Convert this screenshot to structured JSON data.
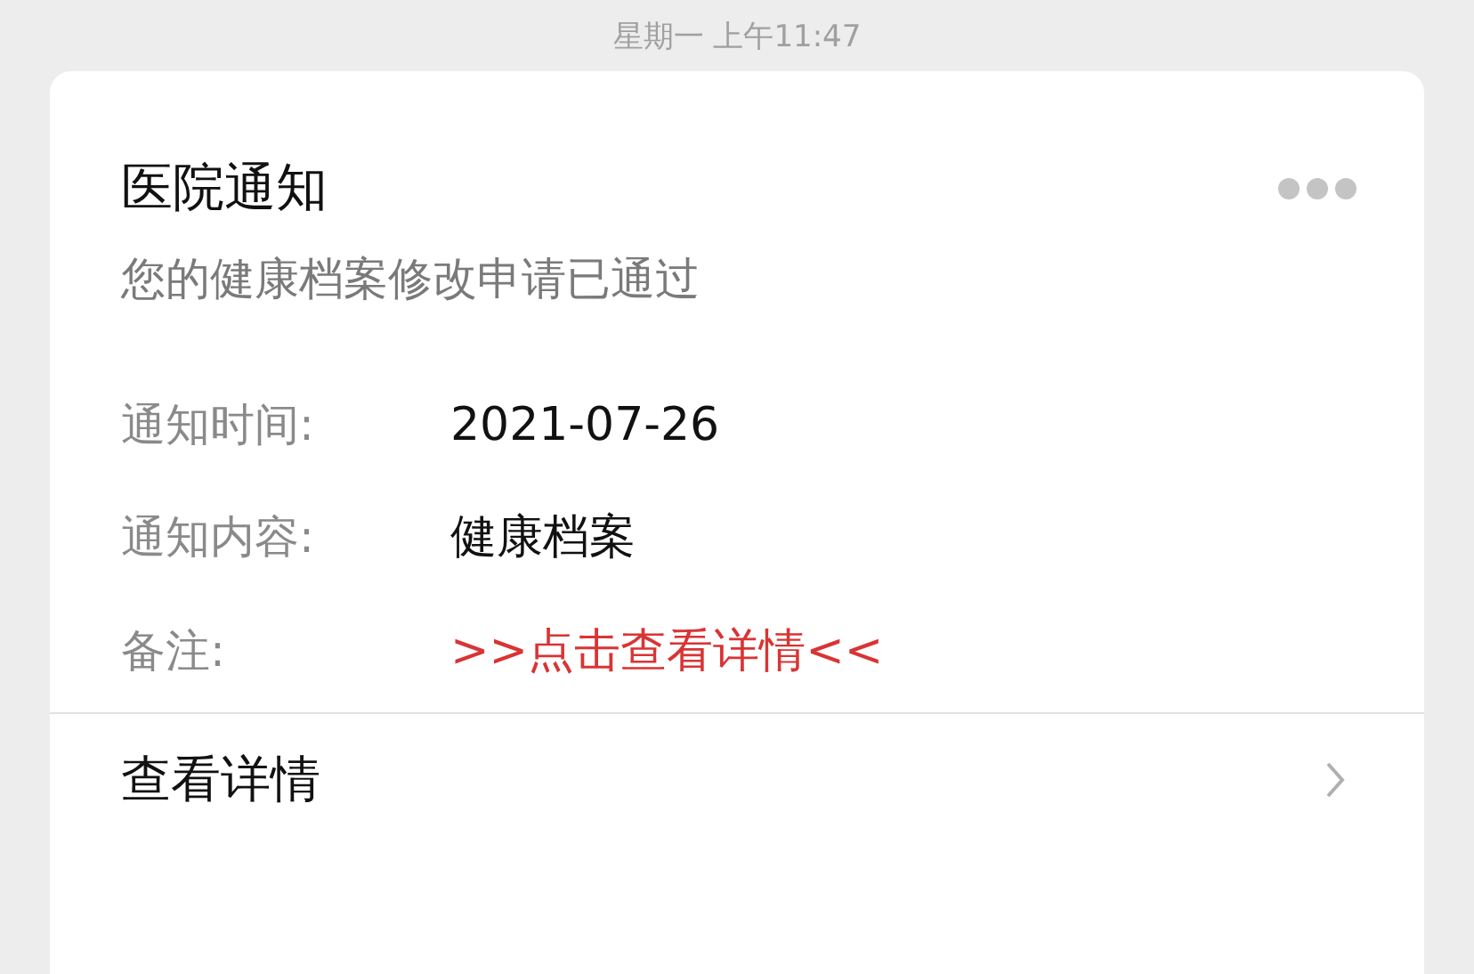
{
  "timestamp": "星期一 上午11:47",
  "card": {
    "title": "医院通知",
    "subtitle": "您的健康档案修改申请已通过",
    "fields": [
      {
        "label": "通知时间:",
        "value": "2021-07-26",
        "kind": "plain"
      },
      {
        "label": "通知内容:",
        "value": "健康档案",
        "kind": "plain"
      },
      {
        "label": "备注:",
        "value": ">>点击查看详情<<",
        "kind": "link"
      }
    ],
    "footer": "查看详情"
  }
}
